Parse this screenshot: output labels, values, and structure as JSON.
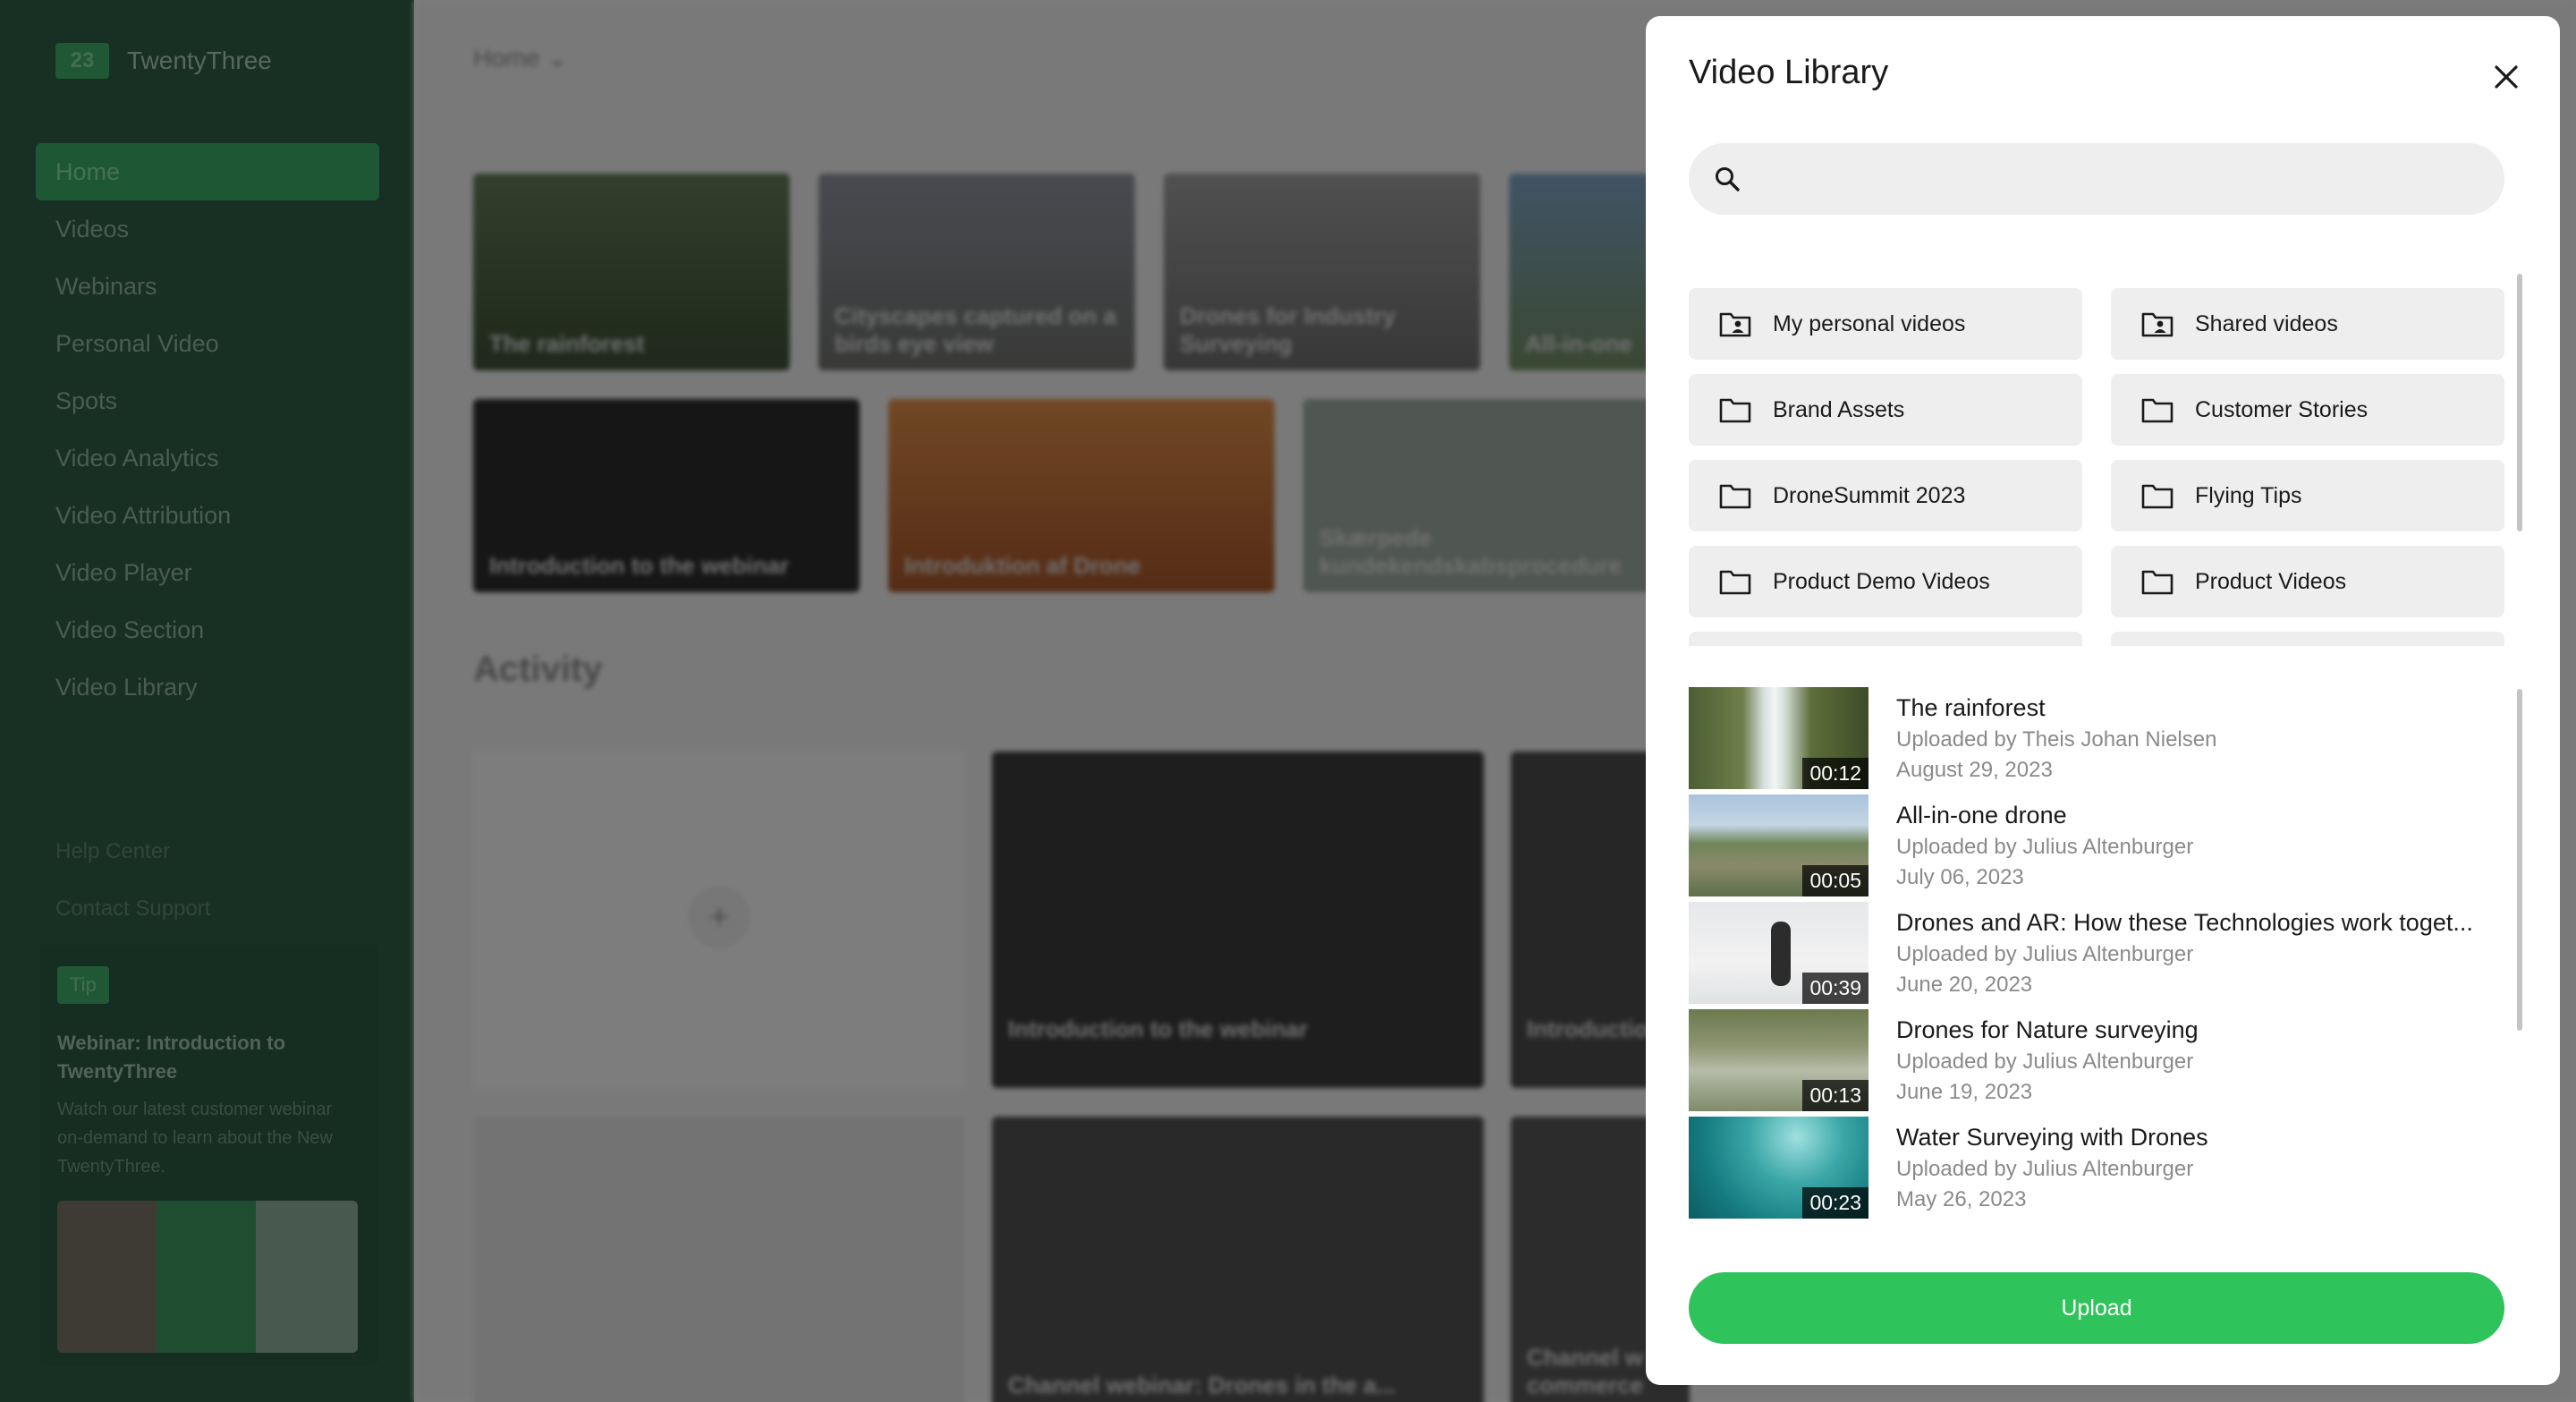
{
  "app": {
    "logo_text": "23",
    "name": "TwentyThree"
  },
  "sidebar": {
    "items": [
      {
        "label": "Home"
      },
      {
        "label": "Videos"
      },
      {
        "label": "Webinars"
      },
      {
        "label": "Personal Video"
      },
      {
        "label": "Spots"
      },
      {
        "label": "Video Analytics"
      },
      {
        "label": "Video Attribution"
      },
      {
        "label": "Video Player"
      },
      {
        "label": "Video Section"
      },
      {
        "label": "Video Library"
      }
    ],
    "support": [
      "Help Center",
      "Contact Support"
    ],
    "tip": {
      "badge": "Tip",
      "title": "Webinar: Introduction to TwentyThree",
      "text": "Watch our latest customer webinar on-demand to learn about the New TwentyThree."
    }
  },
  "main": {
    "breadcrumb": "Home",
    "cards": [
      {
        "title": "The rainforest"
      },
      {
        "title": "Cityscapes captured on a birds eye view"
      },
      {
        "title": "Drones for Industry Surveying"
      },
      {
        "title": "All-in-one"
      },
      {
        "title": "Introduction to the webinar"
      },
      {
        "title": "Introduktion af Drone"
      },
      {
        "title": "Skærpede kundekendskabsprocedure"
      }
    ],
    "activity_heading": "Activity",
    "activity_cards": [
      {
        "title": "Introduction to the webinar"
      },
      {
        "title": "Introductio"
      },
      {
        "title": "Channel webinar: Drones in the a..."
      },
      {
        "title": "Channel w commerce"
      }
    ]
  },
  "modal": {
    "title": "Video Library",
    "search": {
      "placeholder": "",
      "value": ""
    },
    "folders": [
      {
        "label": "My personal videos",
        "icon": "folder-user-icon"
      },
      {
        "label": "Shared videos",
        "icon": "folder-user-icon"
      },
      {
        "label": "Brand Assets",
        "icon": "folder-icon"
      },
      {
        "label": "Customer Stories",
        "icon": "folder-icon"
      },
      {
        "label": "DroneSummit 2023",
        "icon": "folder-icon"
      },
      {
        "label": "Flying Tips",
        "icon": "folder-icon"
      },
      {
        "label": "Product Demo Videos",
        "icon": "folder-icon"
      },
      {
        "label": "Product Videos",
        "icon": "folder-icon"
      }
    ],
    "videos": [
      {
        "title": "The rainforest",
        "uploader": "Uploaded by Theis Johan Nielsen",
        "date": "August 29, 2023",
        "duration": "00:12"
      },
      {
        "title": "All-in-one drone",
        "uploader": "Uploaded by Julius Altenburger",
        "date": "July 06, 2023",
        "duration": "00:05"
      },
      {
        "title": "Drones and AR: How these Technologies work toget...",
        "uploader": "Uploaded by Julius Altenburger",
        "date": "June 20, 2023",
        "duration": "00:39"
      },
      {
        "title": "Drones for Nature surveying",
        "uploader": "Uploaded by Julius Altenburger",
        "date": "June 19, 2023",
        "duration": "00:13"
      },
      {
        "title": "Water Surveying with Drones",
        "uploader": "Uploaded by Julius Altenburger",
        "date": "May 26, 2023",
        "duration": "00:23"
      }
    ],
    "upload_label": "Upload"
  },
  "colors": {
    "accent": "#2fc35b",
    "sidebar": "#2e5c44",
    "overlay": "rgba(0,0,0,0.48)"
  }
}
